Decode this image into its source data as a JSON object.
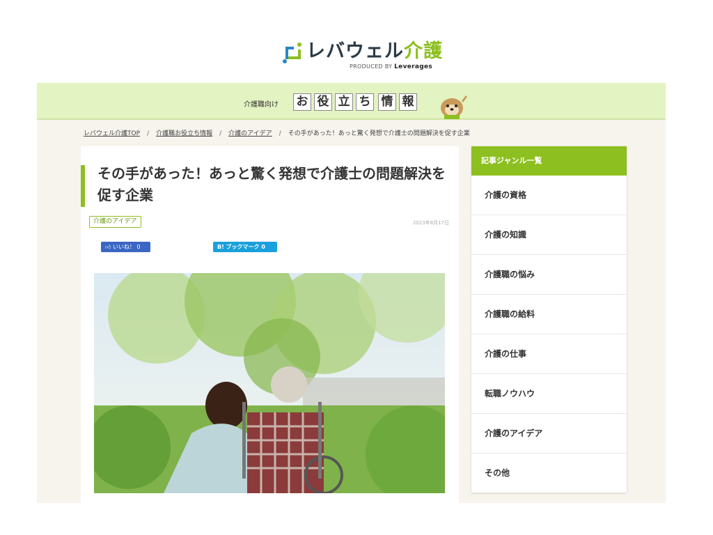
{
  "logo": {
    "text_main": "レバウェル",
    "text_accent": "介護",
    "produced_by": "PRODUCED BY",
    "brand": "Leverages"
  },
  "band": {
    "label": "介護職向け",
    "chars": [
      "お",
      "役",
      "立",
      "ち",
      "情",
      "報"
    ]
  },
  "breadcrumb": {
    "items": [
      "レバウェル介護TOP",
      "介護職お役立ち情報",
      "介護のアイデア",
      "その手があった！あっと驚く発想で介護士の問題解決を促す企業"
    ]
  },
  "article": {
    "title": "その手があった！あっと驚く発想で介護士の問題解決を促す企業",
    "tag": "介護のアイデア",
    "date": "2023年8月17日",
    "like_label": "いいね！ 0",
    "hatena_label": "B! ブックマーク 0"
  },
  "sidebar": {
    "heading": "記事ジャンル一覧",
    "items": [
      "介護の資格",
      "介護の知識",
      "介護職の悩み",
      "介護職の給料",
      "介護の仕事",
      "転職ノウハウ",
      "介護のアイデア",
      "その他"
    ]
  },
  "colors": {
    "accent": "#8cbf1f",
    "band": "#e3f3c2",
    "facebook": "#3b66c4",
    "hatena": "#1aa0dc"
  }
}
